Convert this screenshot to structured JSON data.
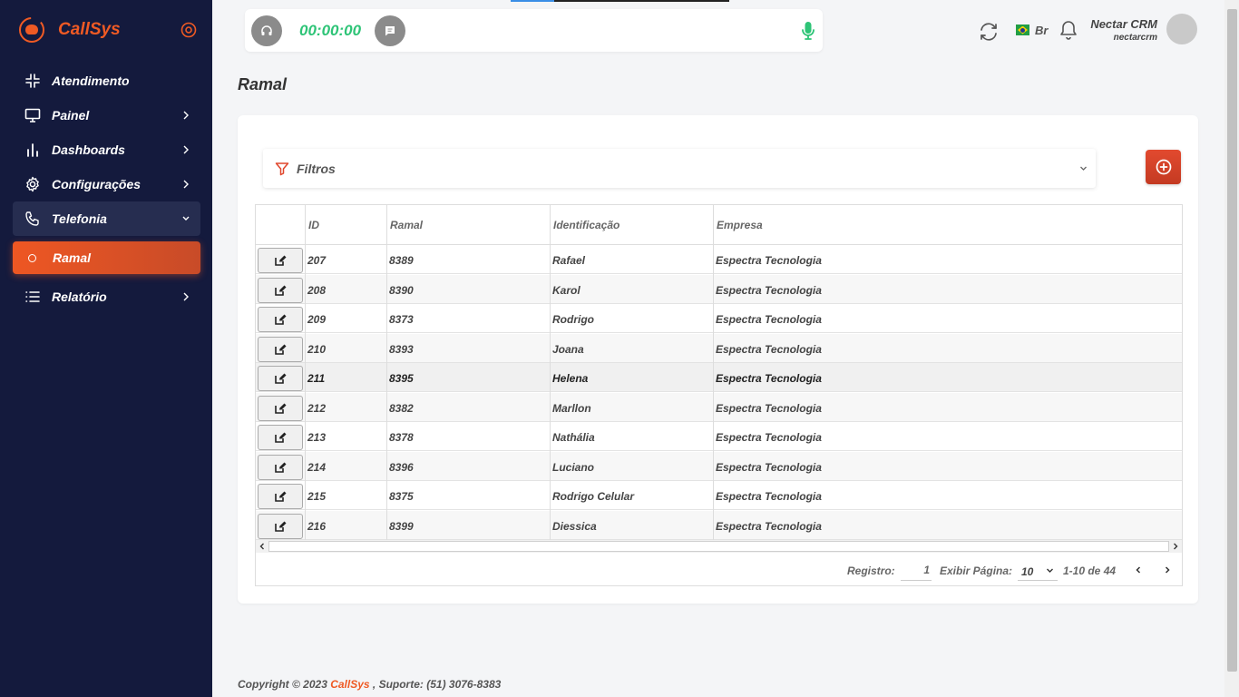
{
  "brand": {
    "name": "CallSys",
    "accent": "#ef5a24",
    "sidebar_bg": "#141a3d"
  },
  "nav": {
    "items": [
      {
        "label": "Atendimento",
        "icon": "slack-grid-icon"
      },
      {
        "label": "Painel",
        "icon": "monitor-icon"
      },
      {
        "label": "Dashboards",
        "icon": "bar-chart-icon"
      },
      {
        "label": "Configurações",
        "icon": "gear-icon"
      },
      {
        "label": "Telefonia",
        "icon": "phone-icon",
        "expanded": true
      },
      {
        "label": "Relatório",
        "icon": "list-icon"
      }
    ],
    "sub_active": "Ramal"
  },
  "callbar": {
    "timer": "00:00:00",
    "timer_color": "#2ec477"
  },
  "header": {
    "language": "Br",
    "user_name": "Nectar CRM",
    "user_login": "nectarcrm"
  },
  "page": {
    "title": "Ramal"
  },
  "filter": {
    "label": "Filtros"
  },
  "table": {
    "columns": [
      "ID",
      "Ramal",
      "Identificação",
      "Empresa"
    ],
    "rows": [
      [
        "207",
        "8389",
        "Rafael",
        "Espectra Tecnologia"
      ],
      [
        "208",
        "8390",
        "Karol",
        "Espectra Tecnologia"
      ],
      [
        "209",
        "8373",
        "Rodrigo",
        "Espectra Tecnologia"
      ],
      [
        "210",
        "8393",
        "Joana",
        "Espectra Tecnologia"
      ],
      [
        "211",
        "8395",
        "Helena",
        "Espectra Tecnologia"
      ],
      [
        "212",
        "8382",
        "Marllon",
        "Espectra Tecnologia"
      ],
      [
        "213",
        "8378",
        "Nathália",
        "Espectra Tecnologia"
      ],
      [
        "214",
        "8396",
        "Luciano",
        "Espectra Tecnologia"
      ],
      [
        "215",
        "8375",
        "Rodrigo Celular",
        "Espectra Tecnologia"
      ],
      [
        "216",
        "8399",
        "Diessica",
        "Espectra Tecnologia"
      ]
    ]
  },
  "pager": {
    "registro_label": "Registro:",
    "registro_value": "1",
    "exibir_label": "Exibir Página:",
    "page_size": "10",
    "range": "1-10 de 44"
  },
  "footer": {
    "prefix": "Copyright © 2023 ",
    "brand": "CallSys",
    "suffix": " , Suporte: (51) 3076-8383"
  }
}
